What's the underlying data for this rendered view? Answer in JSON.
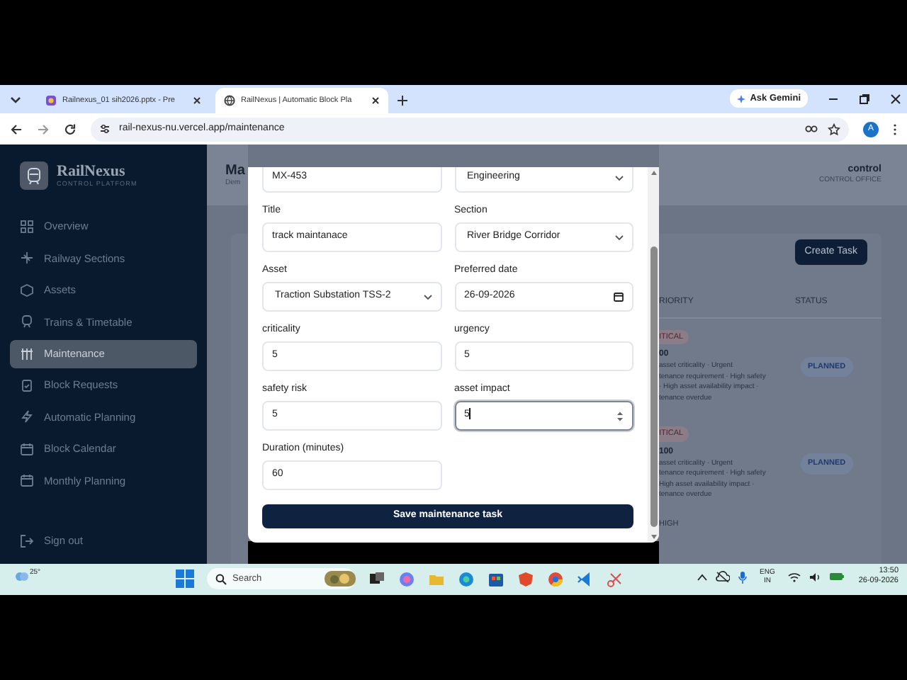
{
  "browser": {
    "tabs": [
      {
        "title": "Railnexus_01 sih2026.pptx - Pre",
        "selected": false
      },
      {
        "title": "RailNexus | Automatic Block Pla",
        "selected": true
      }
    ],
    "url": "rail-nexus-nu.vercel.app/maintenance",
    "assistant_button": "Ask Gemini",
    "profile": "A"
  },
  "sidebar": {
    "brand": "RailNexus",
    "tagline": "CONTROL PLATFORM",
    "items": [
      {
        "label": "Overview",
        "selected": false
      },
      {
        "label": "Railway Sections",
        "selected": false
      },
      {
        "label": "Assets",
        "selected": false
      },
      {
        "label": "Trains & Timetable",
        "selected": false
      },
      {
        "label": "Maintenance",
        "selected": true
      },
      {
        "label": "Block Requests",
        "selected": false
      },
      {
        "label": "Automatic Planning",
        "selected": false
      },
      {
        "label": "Block Calendar",
        "selected": false
      },
      {
        "label": "Monthly Planning",
        "selected": false
      }
    ],
    "sign_out": "Sign out"
  },
  "header": {
    "title": "Ma",
    "subtitle": "Dem",
    "user": "control",
    "role": "CONTROL OFFICE"
  },
  "modal": {
    "fields": [
      {
        "value": "MX-453",
        "kind": "text",
        "focused": false
      },
      {
        "value": "Engineering",
        "kind": "select",
        "focused": false
      },
      {
        "label": "Title",
        "value": "track maintanace",
        "kind": "text",
        "focused": false
      },
      {
        "label": "Section",
        "value": "River Bridge Corridor",
        "kind": "select",
        "focused": false
      },
      {
        "label": "Asset",
        "value": "Traction Substation TSS-2",
        "kind": "select",
        "focused": false
      },
      {
        "label": "Preferred date",
        "value": "26-09-2026",
        "kind": "date",
        "focused": false
      },
      {
        "label": "criticality",
        "value": "5",
        "kind": "text",
        "focused": false
      },
      {
        "label": "urgency",
        "value": "5",
        "kind": "text",
        "focused": false
      },
      {
        "label": "safety risk",
        "value": "5",
        "kind": "text",
        "focused": false
      },
      {
        "label": "asset impact",
        "value": "5",
        "kind": "number",
        "focused": true
      },
      {
        "label": "Duration (minutes)",
        "value": "60",
        "kind": "text",
        "focused": false
      }
    ],
    "save_button": "Save maintenance task"
  },
  "tasks": {
    "create_button": "Create Task",
    "columns": [
      "RIORITY",
      "STATUS"
    ],
    "rows": [
      {
        "priority": "ITICAL",
        "score": "00",
        "reasons": [
          "asset criticality · Urgent",
          "tenance requirement · High safety",
          "· High asset availability impact ·",
          "tenance overdue"
        ],
        "status": "PLANNED"
      },
      {
        "priority": "ITICAL",
        "score": "100",
        "reasons": [
          "asset criticality · Urgent",
          "tenance requirement · High safety",
          "High asset availability impact ·",
          "tenance overdue"
        ],
        "status": "PLANNED"
      }
    ],
    "next_priority": "HIGH"
  },
  "taskbar": {
    "weather": "25°",
    "search_placeholder": "Search",
    "language": "ENG",
    "region": "IN",
    "time": "13:50",
    "date": "26-09-2026"
  }
}
